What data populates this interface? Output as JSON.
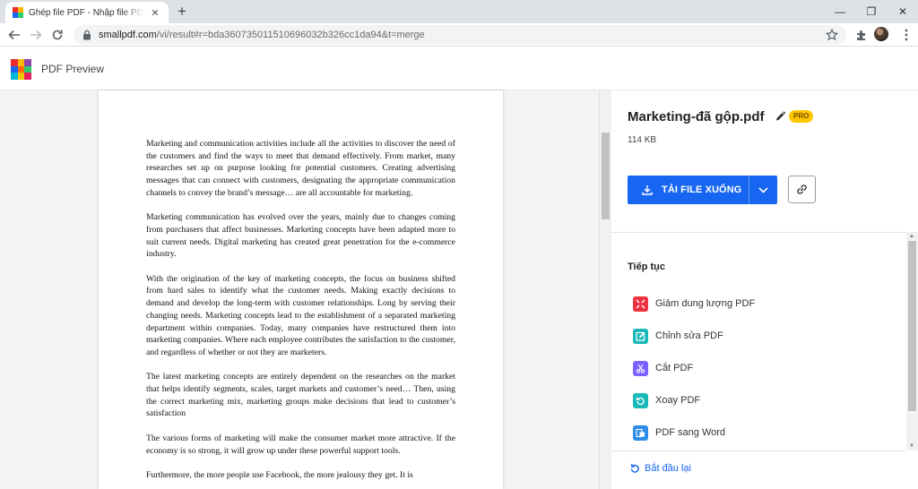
{
  "browser": {
    "tab_title": "Ghép file PDF - Nhập file PDF trực tuyến",
    "tab_close": "✕",
    "new_tab": "+",
    "url_host": "smallpdf.com",
    "url_path": "/vi/result#r=bda360735011510696032b326cc1da94&t=merge",
    "window_minimize": "—",
    "window_restore": "❐",
    "window_close": "✕"
  },
  "app": {
    "title": "PDF Preview",
    "logo_colors": [
      "#ee2a31",
      "#ffb800",
      "#8e44ad",
      "#1766f2",
      "#ff6d00",
      "#2ecc71",
      "#00b8d9",
      "#f7c600",
      "#e91e63"
    ]
  },
  "document": {
    "paragraphs": [
      "Marketing and communication activities include all the activities to discover the need of the customers and find the ways to meet that demand effectively. From market, many researches set up on purpose looking for potential customers. Creating advertising messages that can connect with customers, designating the appropriate communication channels to convey the brand’s message… are all accountable for marketing.",
      "Marketing communication has evolved over the years, mainly due to changes coming from purchasers that affect businesses. Marketing concepts have been adapted more to suit current needs. Digital marketing has created great penetration for the e-commerce industry.",
      "With the origination of the key of marketing concepts, the focus on business shifted from hard sales to identify what the customer needs. Making exactly decisions to demand and develop the long-term with customer relationships. Long by serving their changing needs. Marketing concepts lead to the establishment of a separated marketing department within companies. Today, many companies have restructured them into marketing companies. Where each employee contributes the satisfaction to the customer, and regardless of whether or not they are marketers.",
      "The latest marketing concepts are entirely dependent on the researches on the market that helps identify segments, scales, target markets and customer’s need… Then, using the correct marketing mix, marketing groups make decisions that lead to customer’s satisfaction",
      "The various forms of marketing will make the consumer market more attractive. If the economy is so strong, it will grow up under these powerful support tools.",
      "Furthermore, the more people use Facebook, the more jealousy they get. It is"
    ]
  },
  "file": {
    "name": "Marketing-đã gộp.pdf",
    "badge": "PRO",
    "size": "114 KB"
  },
  "actions": {
    "download_label": "TẢI FILE XUỐNG",
    "primary_color": "#1766f2"
  },
  "continue": {
    "title": "Tiếp tục",
    "tools": [
      {
        "label": "Giảm dung lượng PDF",
        "icon": "compress-icon",
        "color": "#ee3340"
      },
      {
        "label": "Chỉnh sửa PDF",
        "icon": "edit-icon",
        "color": "#19b9b8"
      },
      {
        "label": "Cắt PDF",
        "icon": "scissors-icon",
        "color": "#7b61ff"
      },
      {
        "label": "Xoay PDF",
        "icon": "rotate-icon",
        "color": "#19b9b8"
      },
      {
        "label": "PDF sang Word",
        "icon": "word-icon",
        "color": "#2f8ce8"
      }
    ]
  },
  "restart_label": "Bắt đầu lại"
}
